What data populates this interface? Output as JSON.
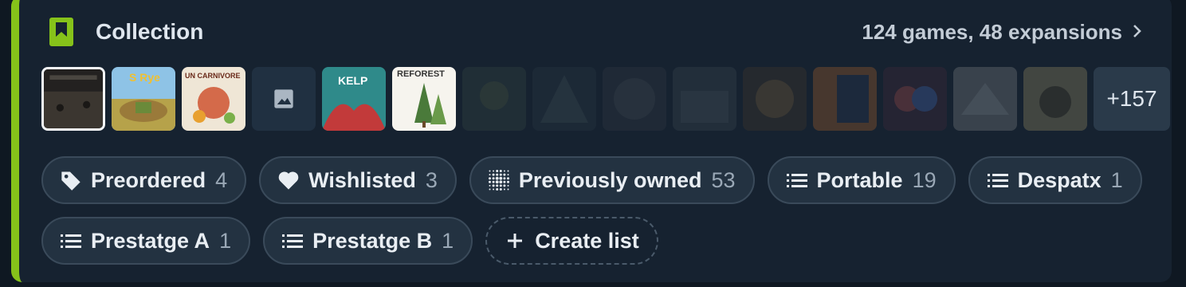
{
  "header": {
    "title": "Collection",
    "summary": "124 games, 48 expansions",
    "accent": "#86c21a"
  },
  "thumbnails": {
    "items": [
      {
        "name": "thumb-dark-box",
        "dim": false
      },
      {
        "name": "thumb-sky-game",
        "dim": false,
        "label": "S Rye"
      },
      {
        "name": "thumb-un-carnivore",
        "dim": false,
        "label": "UN CARNIVORE"
      },
      {
        "name": "thumb-placeholder",
        "dim": false
      },
      {
        "name": "thumb-kelp",
        "dim": false,
        "label": "KELP"
      },
      {
        "name": "thumb-reforest",
        "dim": false,
        "label": "REFOREST"
      }
    ],
    "more_label": "+157"
  },
  "lists": [
    {
      "label": "Preordered",
      "count": "4",
      "icon": "tag-icon"
    },
    {
      "label": "Wishlisted",
      "count": "3",
      "icon": "heart-icon"
    },
    {
      "label": "Previously owned",
      "count": "53",
      "icon": "dots-grid-icon"
    },
    {
      "label": "Portable",
      "count": "19",
      "icon": "list-icon"
    },
    {
      "label": "Despatx",
      "count": "1",
      "icon": "list-icon"
    },
    {
      "label": "Prestatge A",
      "count": "1",
      "icon": "list-icon"
    },
    {
      "label": "Prestatge B",
      "count": "1",
      "icon": "list-icon"
    }
  ],
  "create_list_label": "Create list"
}
